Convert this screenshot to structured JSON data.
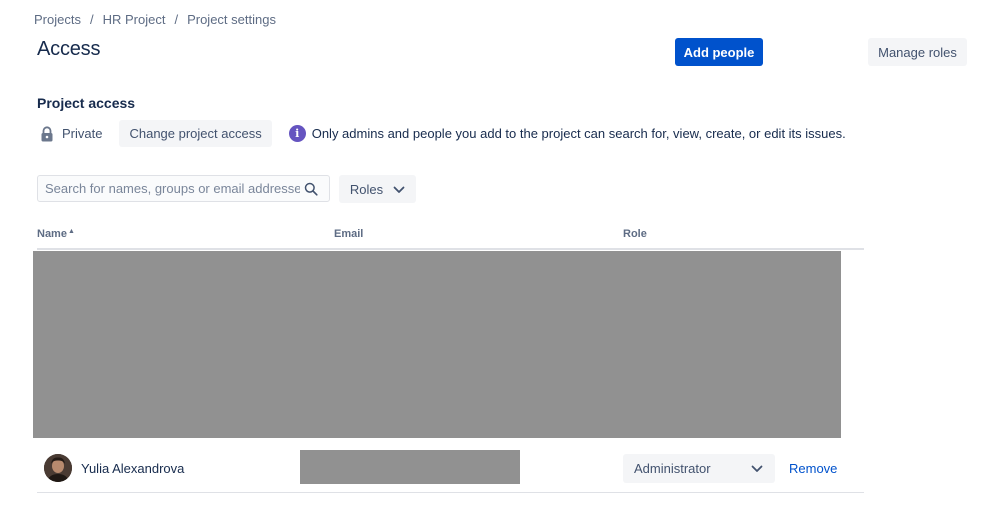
{
  "breadcrumb": {
    "items": [
      "Projects",
      "HR Project",
      "Project settings"
    ],
    "separator": "/"
  },
  "page": {
    "title": "Access"
  },
  "header_actions": {
    "add_people_label": "Add people",
    "manage_roles_label": "Manage roles"
  },
  "project_access": {
    "section_title": "Project access",
    "lock_icon": "lock-icon",
    "visibility_label": "Private",
    "change_button_label": "Change project access",
    "info_icon": "info-icon",
    "info_text": "Only admins and people you add to the project can search for, view, create, or edit its issues."
  },
  "filters": {
    "search_placeholder": "Search for names, groups or email addresses",
    "search_value": "",
    "roles_button_label": "Roles"
  },
  "table": {
    "columns": {
      "name": "Name",
      "email": "Email",
      "role": "Role"
    },
    "sort_column": "Name",
    "sort_direction": "ascending",
    "rows": [
      {
        "name": "Yulia Alexandrova",
        "role": "Administrator",
        "remove_label": "Remove"
      }
    ]
  },
  "colors": {
    "primary": "#0052cc",
    "text": "#172b4d",
    "subtle_text": "#5e6c84",
    "button_bg": "#f4f5f7",
    "info_purple": "#6554c0",
    "redaction": "#919191",
    "border": "#dfe1e6"
  }
}
